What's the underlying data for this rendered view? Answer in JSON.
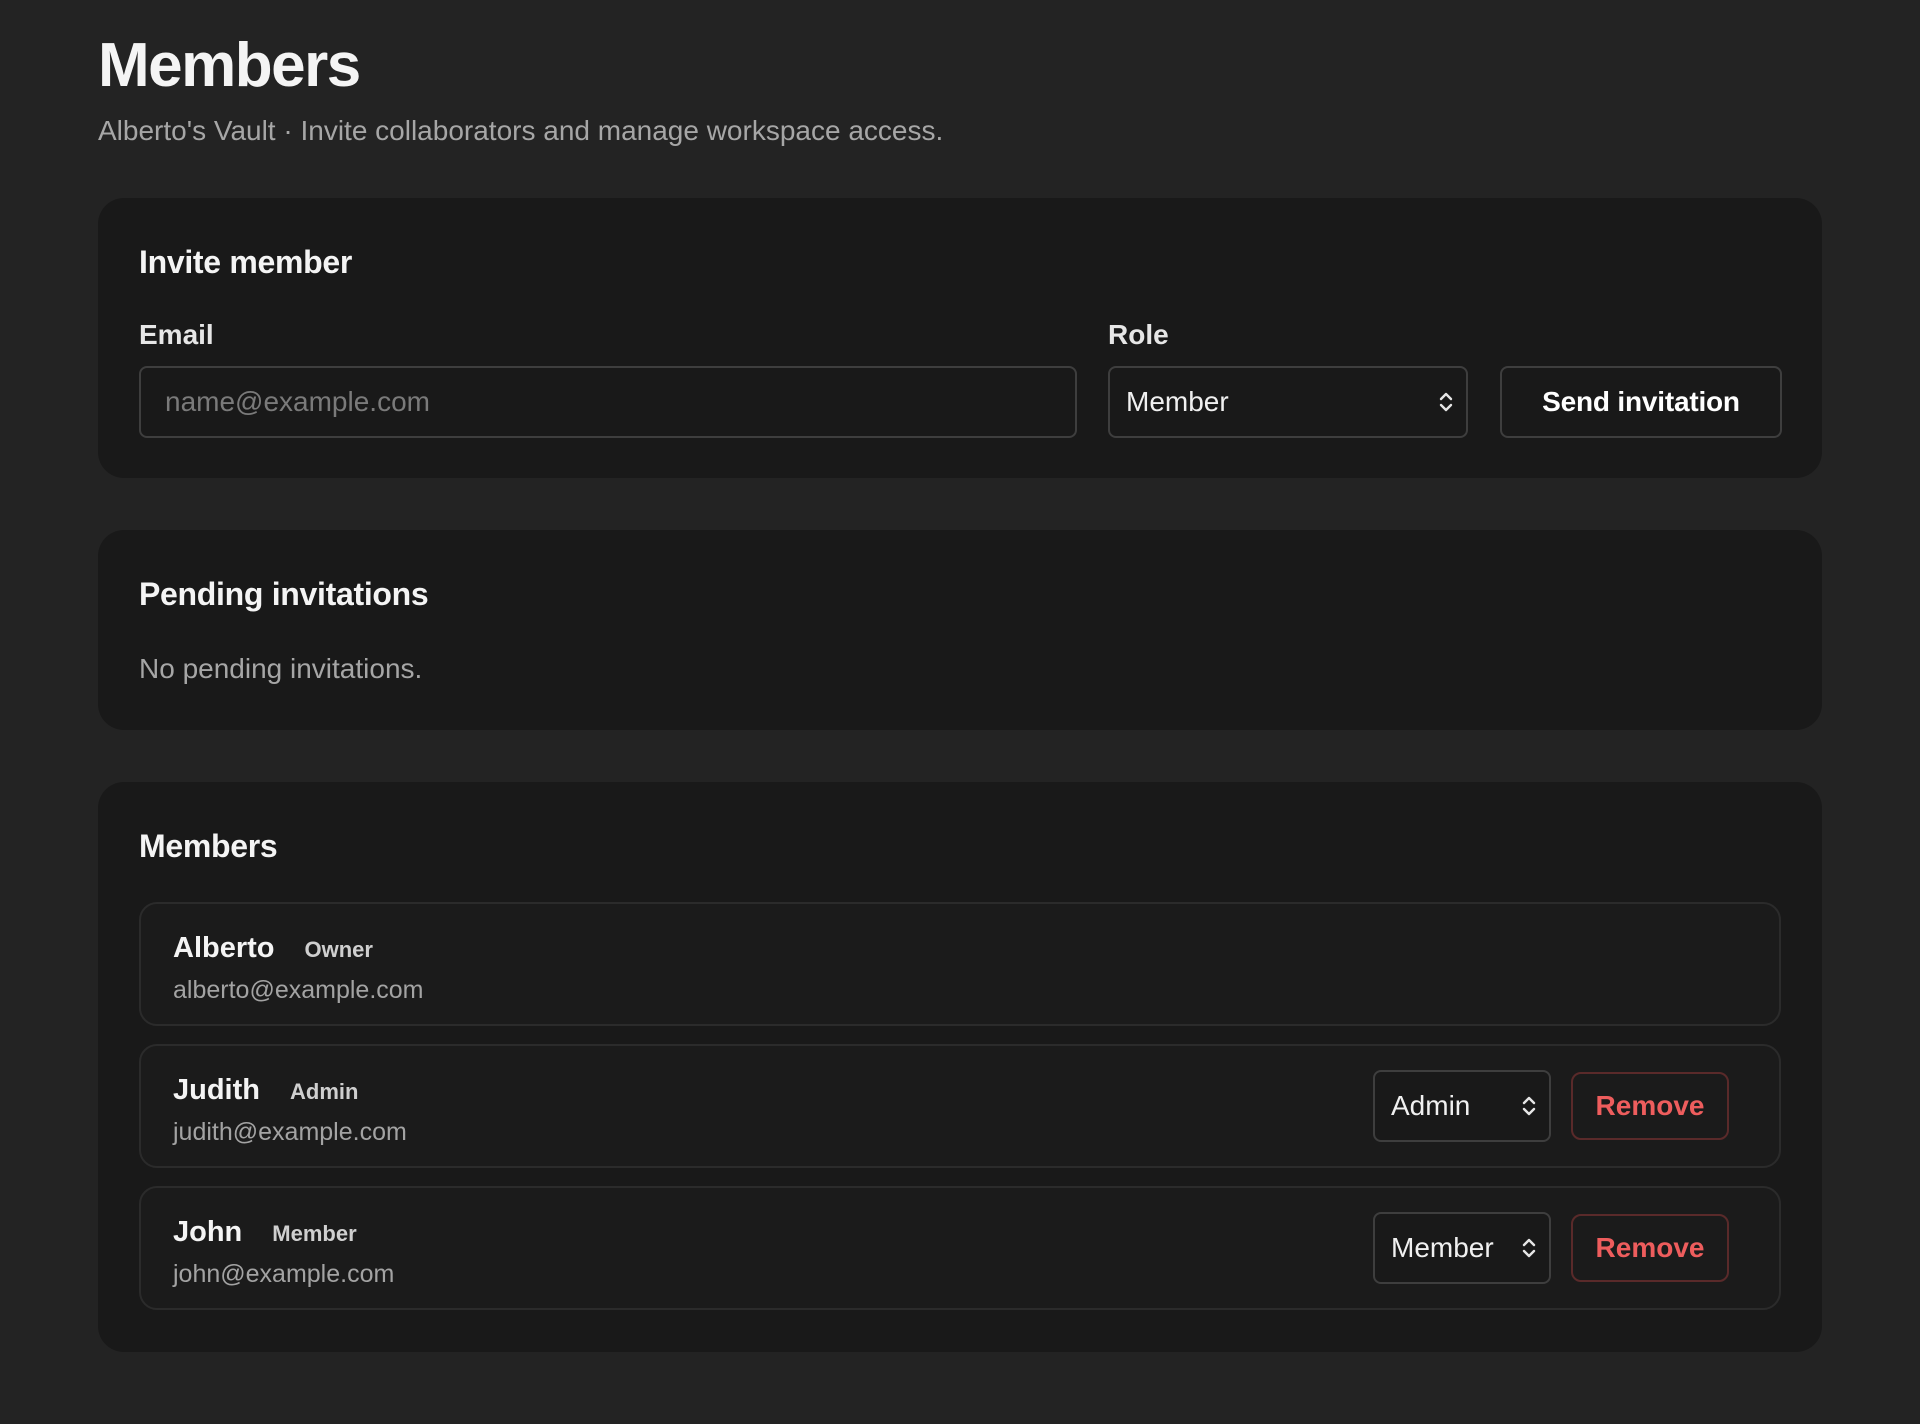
{
  "header": {
    "title": "Members",
    "subtitle": "Alberto's Vault · Invite collaborators and manage workspace access."
  },
  "invite": {
    "title": "Invite member",
    "email_label": "Email",
    "email_placeholder": "name@example.com",
    "email_value": "",
    "role_label": "Role",
    "role_value": "Member",
    "send_label": "Send invitation"
  },
  "pending": {
    "title": "Pending invitations",
    "empty_text": "No pending invitations."
  },
  "members": {
    "title": "Members",
    "rows": [
      {
        "name": "Alberto",
        "badge": "Owner",
        "email": "alberto@example.com",
        "role": "",
        "remove_label": ""
      },
      {
        "name": "Judith",
        "badge": "Admin",
        "email": "judith@example.com",
        "role": "Admin",
        "remove_label": "Remove"
      },
      {
        "name": "John",
        "badge": "Member",
        "email": "john@example.com",
        "role": "Member",
        "remove_label": "Remove"
      }
    ]
  },
  "colors": {
    "background": "#232323",
    "card": "#191919",
    "danger": "#ee5d5d"
  },
  "icons": {
    "select_chevron": "chevron-up-down-icon"
  }
}
